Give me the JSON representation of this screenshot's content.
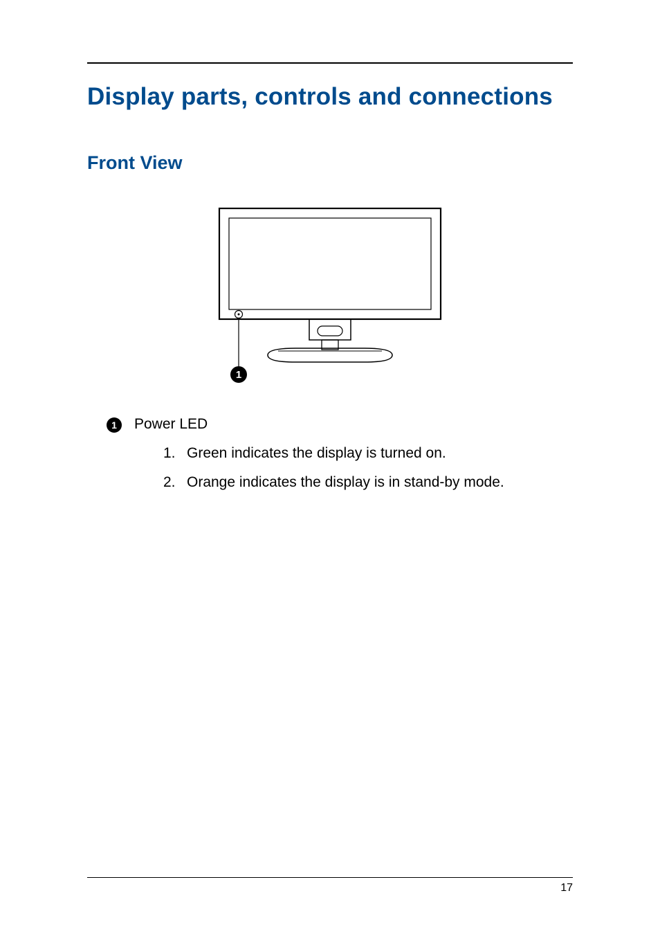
{
  "title": "Display parts, controls and connections",
  "subtitle": "Front View",
  "diagram": {
    "callout_number": "1",
    "alt": "Front view of a computer display on a stand, with a small LED on the lower-left bezel labeled 1"
  },
  "callouts": [
    {
      "number": "1",
      "label": "Power LED",
      "items": [
        {
          "num": "1.",
          "text": "Green indicates the display is turned on."
        },
        {
          "num": "2.",
          "text": "Orange indicates the display is in stand-by mode."
        }
      ]
    }
  ],
  "page_number": "17",
  "colors": {
    "heading": "#004b8d"
  }
}
